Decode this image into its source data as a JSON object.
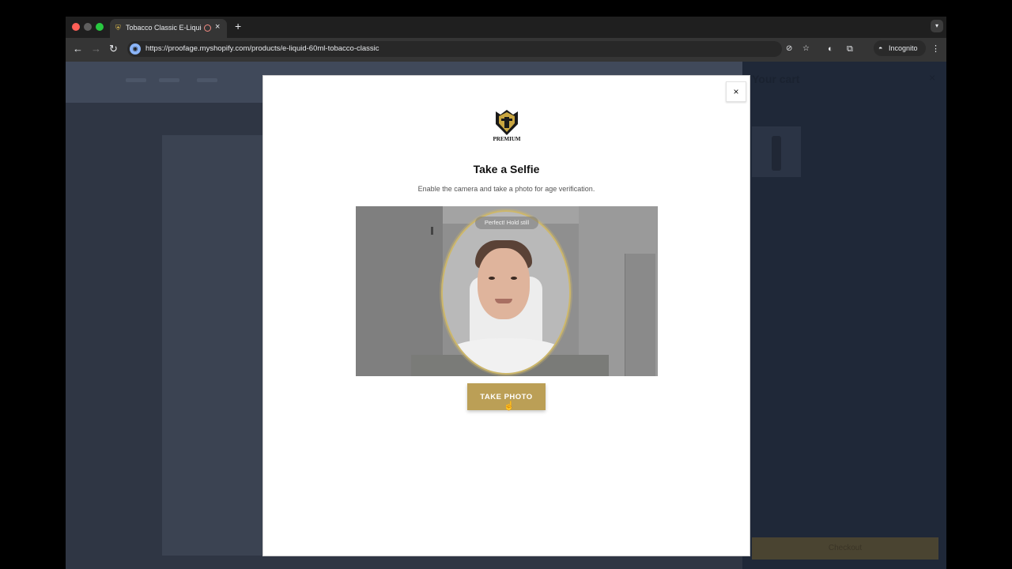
{
  "browser": {
    "tab_title": "Tobacco Classic E-Liquid",
    "tab_close": "×",
    "new_tab": "+",
    "url": "https://proofage.myshopify.com/products/e-liquid-60ml-tobacco-classic",
    "incognito_label": "Incognito"
  },
  "drawer": {
    "title": "Your cart",
    "close": "×",
    "checkout_label": "Checkout"
  },
  "modal": {
    "close_label": "×",
    "logo_text": "PREMIUM",
    "title": "Take a Selfie",
    "subtitle": "Enable the camera and take a photo for age verification.",
    "camera_status": "Perfect! Hold still",
    "take_photo_label": "TAKE PHOTO"
  },
  "colors": {
    "accent": "#bb9f56",
    "oval_border": "#cdb76a",
    "overlay": "#2f3644"
  }
}
